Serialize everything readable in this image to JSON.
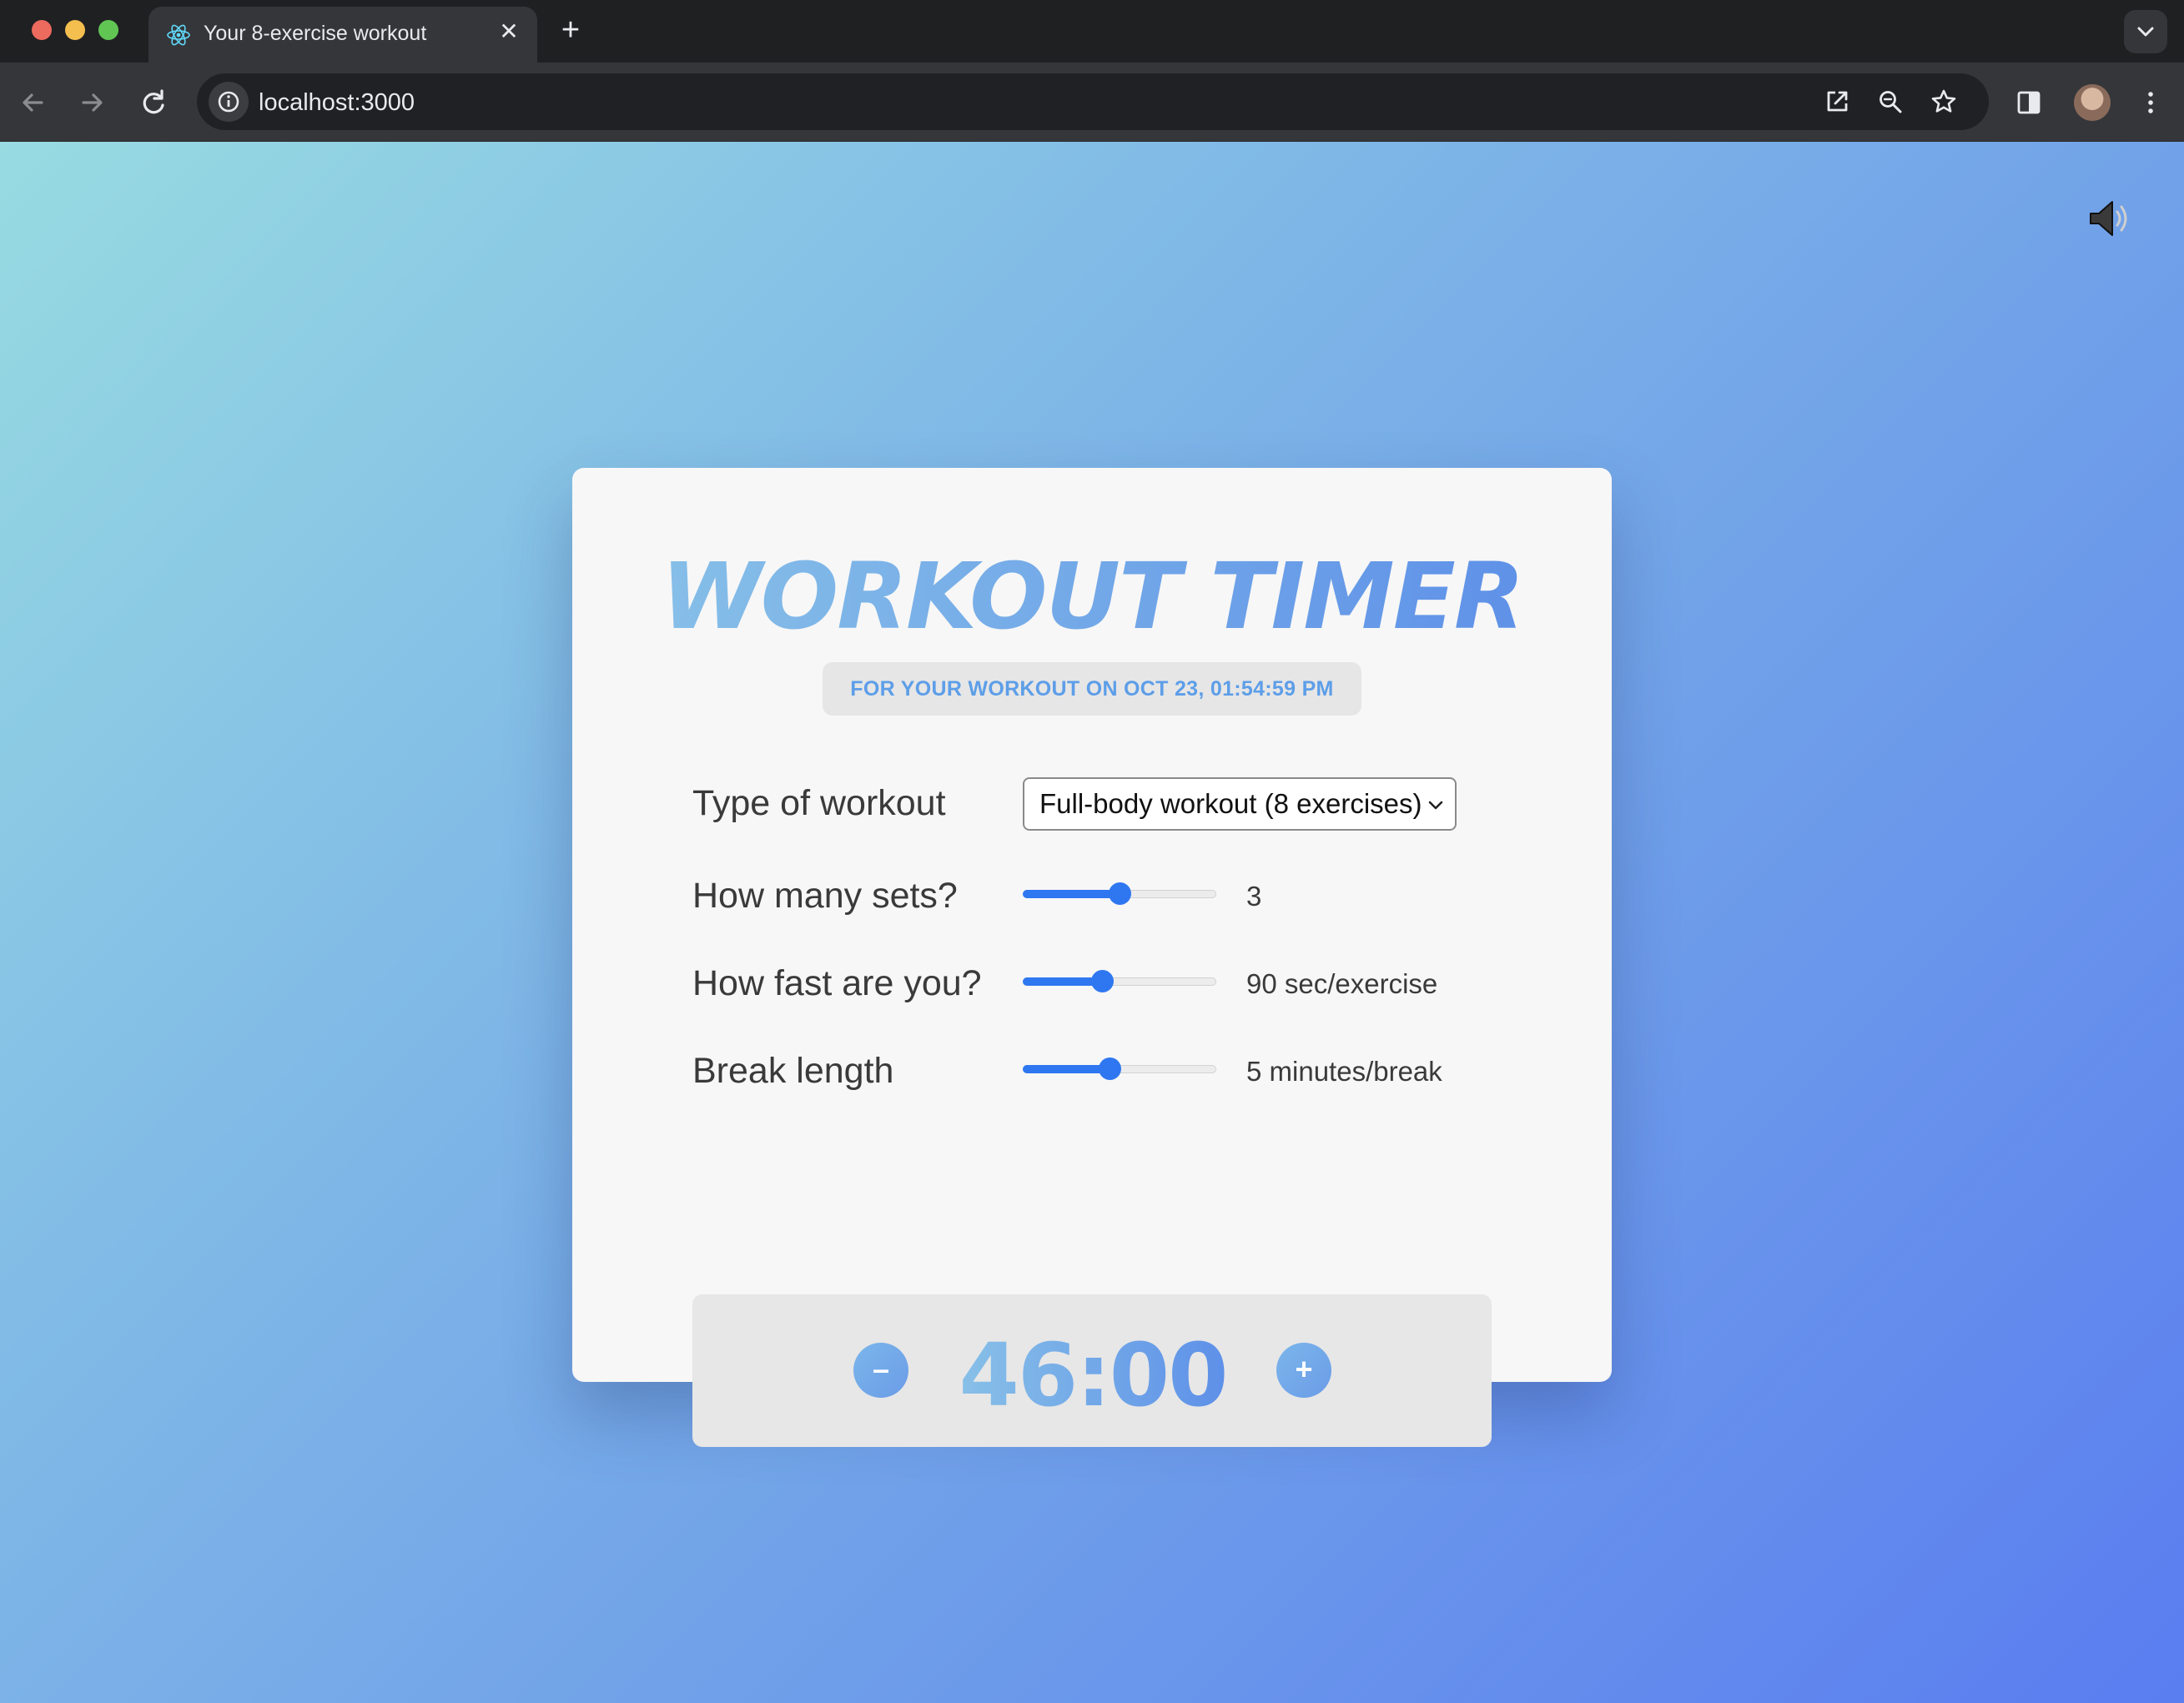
{
  "browser": {
    "tab": {
      "title": "Your 8-exercise workout",
      "close_glyph": "✕",
      "favicon": "react-icon"
    },
    "new_tab_glyph": "+",
    "address": {
      "url": "localhost:3000"
    },
    "icons": [
      "back-arrow-icon",
      "forward-arrow-icon",
      "reload-icon",
      "info-icon",
      "open-external-icon",
      "zoom-icon",
      "star-icon",
      "side-panel-icon",
      "profile-avatar",
      "more-vert-icon",
      "tab-search-icon"
    ]
  },
  "page": {
    "sound_icon": "speaker-icon",
    "title": "WORKOUT TIMER",
    "date_badge": "FOR YOUR WORKOUT ON OCT 23, 01:54:59 PM",
    "rows": {
      "workout_type": {
        "label": "Type of workout",
        "selected": "Full-body workout (8 exercises)"
      },
      "sets": {
        "label": "How many sets?",
        "value": "3",
        "percent": 50
      },
      "speed": {
        "label": "How fast are you?",
        "value": "90 sec/exercise",
        "percent": 41
      },
      "break": {
        "label": "Break length",
        "value": "5 minutes/break",
        "percent": 45
      }
    },
    "timer": {
      "minus_glyph": "–",
      "value": "46:00",
      "plus_glyph": "+"
    },
    "colors": {
      "accent": "#2f77f1",
      "gradient_start": "#8ac3e8",
      "gradient_end": "#5b8de8"
    }
  }
}
